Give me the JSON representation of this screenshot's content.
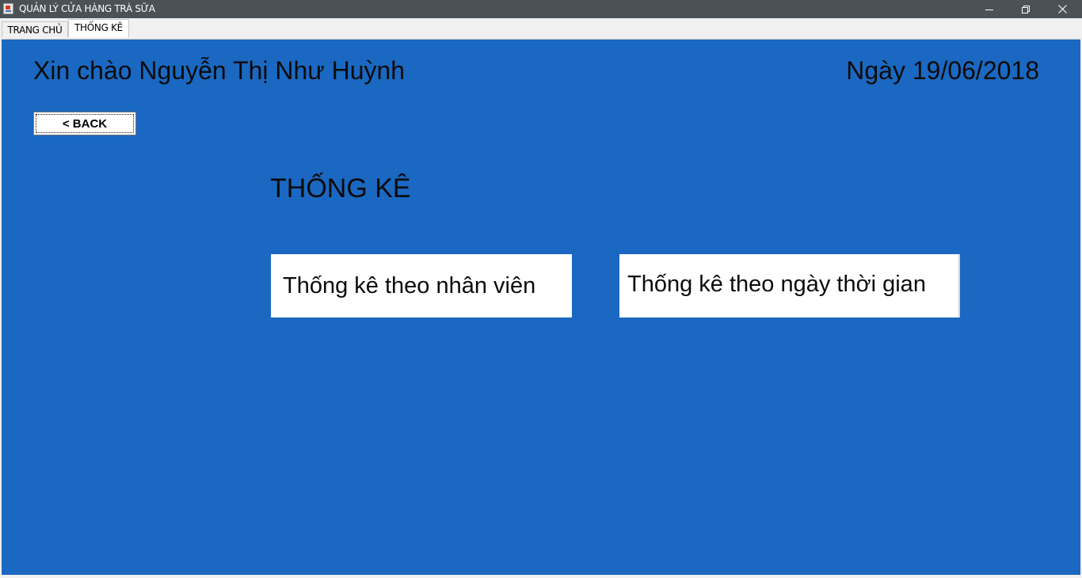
{
  "window": {
    "title": "QUẢN LÝ CỬA HÀNG TRÀ SỮA",
    "icon": "java-app-icon",
    "controls": [
      "minimize-icon",
      "maximize-icon",
      "close-icon"
    ]
  },
  "tabs": [
    {
      "label": "TRANG CHỦ",
      "selected": false
    },
    {
      "label": "THỐNG KÊ",
      "selected": true
    }
  ],
  "header": {
    "greeting": "Xin chào Nguyễn Thị Như Huỳnh",
    "date": "Ngày 19/06/2018"
  },
  "back_button": {
    "label": "< BACK"
  },
  "section_title": "THỐNG KÊ",
  "options": {
    "by_employee": "Thống kê theo nhân viên",
    "by_date": "Thống kê theo ngày thời gian"
  },
  "colors": {
    "titlebar": "#4b5157",
    "panel": "#1a68c1",
    "button_bg": "#ffffff",
    "text": "#0b0b0b"
  }
}
